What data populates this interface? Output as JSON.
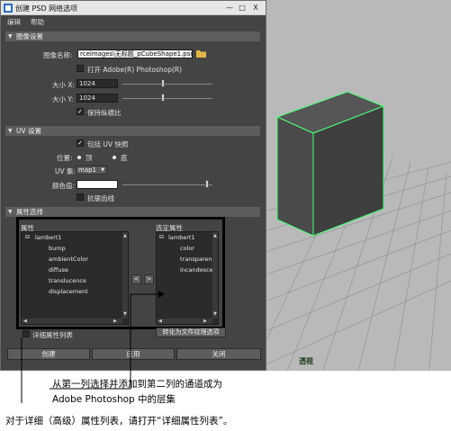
{
  "window": {
    "title": "创建 PSD 网络选项"
  },
  "menu": [
    "编辑",
    "帮助"
  ],
  "image_settings": {
    "header": "图像设置",
    "image_name_label": "图像名称:",
    "image_name_value": "rceimages\\无标题_pCubeShape1.psd",
    "open_ps_label": "打开 Adobe(R) Photoshop(R)",
    "size_x_label": "大小 X:",
    "size_x_value": "1024",
    "size_y_label": "大小 Y:",
    "size_y_value": "1024",
    "keep_ratio_label": "保持纵横比"
  },
  "uv_settings": {
    "header": "UV 设置",
    "include_snapshot_label": "包括 UV 快照",
    "position_label": "位置:",
    "pos_top": "顶",
    "pos_bottom": "底",
    "uvset_label": "UV 集:",
    "uvset_value": "map1",
    "color_label": "颜色值:",
    "antialias_label": "抗锯齿线"
  },
  "attr_select": {
    "header": "属性选择",
    "left_label": "属性",
    "left_items": [
      "lambert1",
      "bump",
      "ambientColor",
      "diffuse",
      "translucence",
      "displacement"
    ],
    "right_label": "选定属性",
    "right_items": [
      "lambert1",
      "color",
      "transparen",
      "incandesce"
    ],
    "move_left": "<",
    "move_right": ">",
    "verbose_label": "详细属性列表",
    "convert_button": "转化为文件纹理选项"
  },
  "buttons": {
    "create": "创建",
    "apply": "应用",
    "close": "关闭"
  },
  "window_controls": {
    "minimize": "—",
    "maximize": "□",
    "close": "X"
  },
  "viewport": {
    "label": "透视",
    "colors": {
      "grid": "#8e8e8e",
      "cube_top": "#565656",
      "cube_left": "#4a4a4a",
      "cube_right": "#3f3f3f",
      "edge": "#4dff7a"
    }
  },
  "annotations": {
    "channel_note_line1": "从第一列选择并添加到第二列的通道成为",
    "channel_note_line2": "Adobe Photoshop 中的层集",
    "verbose_note": "对于详细（高级）属性列表，请打开“详细属性列表”。"
  }
}
